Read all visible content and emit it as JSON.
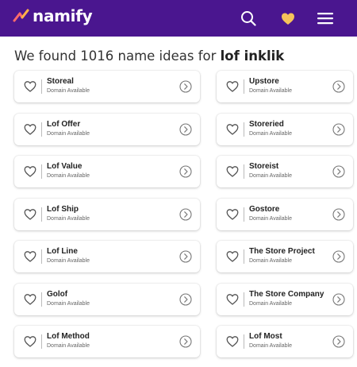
{
  "header": {
    "brand": "namify",
    "background": "#4a168f",
    "icons": [
      "search-icon",
      "heart-icon",
      "menu-icon"
    ],
    "heart_color": "#f6c35a"
  },
  "results": {
    "prefix": "We found 1016 name ideas for",
    "keyword": "lof inklik"
  },
  "names": {
    "left": [
      {
        "name": "Storeal",
        "status": "Domain Available"
      },
      {
        "name": "Lof Offer",
        "status": "Domain Available"
      },
      {
        "name": "Lof Value",
        "status": "Domain Available"
      },
      {
        "name": "Lof Ship",
        "status": "Domain Available"
      },
      {
        "name": "Lof Line",
        "status": "Domain Available"
      },
      {
        "name": "Golof",
        "status": "Domain Available"
      },
      {
        "name": "Lof Method",
        "status": "Domain Available"
      }
    ],
    "right": [
      {
        "name": "Upstore",
        "status": "Domain Available"
      },
      {
        "name": "Storeried",
        "status": "Domain Available"
      },
      {
        "name": "Storeist",
        "status": "Domain Available"
      },
      {
        "name": "Gostore",
        "status": "Domain Available"
      },
      {
        "name": "The Store Project",
        "status": "Domain Available"
      },
      {
        "name": "The Store Company",
        "status": "Domain Available"
      },
      {
        "name": "Lof Most",
        "status": "Domain Available"
      }
    ]
  }
}
